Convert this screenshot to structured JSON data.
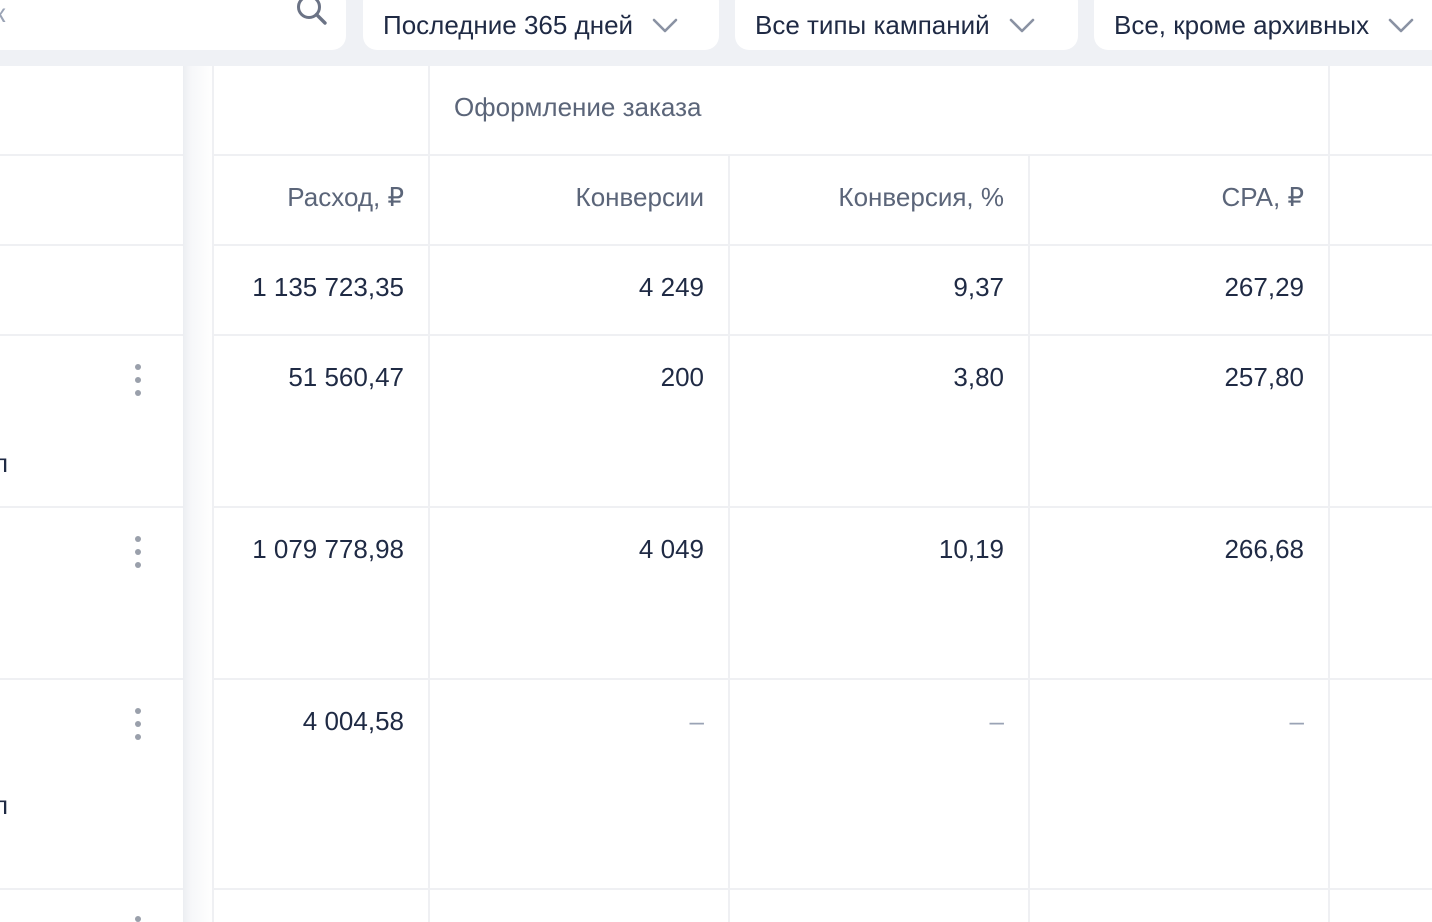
{
  "filters": {
    "search": {
      "partial_text": "к"
    },
    "period": {
      "value": "Последние 365 дней"
    },
    "campaign_types": {
      "value": "Все типы кампаний"
    },
    "status": {
      "value": "Все, кроме архивных"
    }
  },
  "table": {
    "group_header": "Оформление заказа",
    "columns": {
      "spend": "Расход, ₽",
      "conversions": "Конверсии",
      "conversion_rate": "Конверсия, %",
      "cpa": "CPA, ₽"
    },
    "total": {
      "spend": "1 135 723,35",
      "conversions": "4 249",
      "conversion_rate": "9,37",
      "cpa": "267,29"
    },
    "rows": [
      {
        "edge_text": "п",
        "spend": "51 560,47",
        "conversions": "200",
        "conversion_rate": "3,80",
        "cpa": "257,80"
      },
      {
        "edge_text": "",
        "spend": "1 079 778,98",
        "conversions": "4 049",
        "conversion_rate": "10,19",
        "cpa": "266,68"
      },
      {
        "edge_text": "п",
        "spend": "4 004,58",
        "conversions": "–",
        "conversion_rate": "–",
        "cpa": "–"
      }
    ]
  }
}
